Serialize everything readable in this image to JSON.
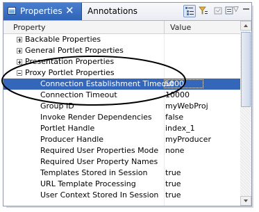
{
  "tabs": {
    "active_label": "Properties",
    "close_glyph": "✕",
    "inactive_label": "Annotations"
  },
  "toolbar": {
    "buttons": [
      "categories-icon",
      "filter-icon",
      "restore-default-icon",
      "advanced-icon"
    ],
    "menu_glyph": "▽"
  },
  "table": {
    "header_property": "Property",
    "header_value": "Value",
    "rows": [
      {
        "name": "Backable Properties",
        "value": "",
        "expander": "plus",
        "indent": 0
      },
      {
        "name": "General Portlet Properties",
        "value": "",
        "expander": "plus",
        "indent": 0
      },
      {
        "name": "Presentation Properties",
        "value": "",
        "expander": "plus",
        "indent": 0
      },
      {
        "name": "Proxy Portlet Properties",
        "value": "",
        "expander": "minus",
        "indent": 0
      },
      {
        "name": "Connection Establishment Timeout",
        "value": "5000",
        "expander": "",
        "indent": 1,
        "selected": true
      },
      {
        "name": "Connection Timeout",
        "value": "10000",
        "expander": "",
        "indent": 1
      },
      {
        "name": "Group ID",
        "value": "myWebProj",
        "expander": "",
        "indent": 1
      },
      {
        "name": "Invoke Render Dependencies",
        "value": "false",
        "expander": "",
        "indent": 1
      },
      {
        "name": "Portlet Handle",
        "value": "index_1",
        "expander": "",
        "indent": 1
      },
      {
        "name": "Producer Handle",
        "value": "myProducer",
        "expander": "",
        "indent": 1
      },
      {
        "name": "Required User Properties Mode",
        "value": "none",
        "expander": "",
        "indent": 1
      },
      {
        "name": "Required User Property Names",
        "value": "",
        "expander": "",
        "indent": 1
      },
      {
        "name": "Templates Stored in Session",
        "value": "true",
        "expander": "",
        "indent": 1
      },
      {
        "name": "URL Template Processing",
        "value": "true",
        "expander": "",
        "indent": 1
      },
      {
        "name": "User Context Stored In Session",
        "value": "true",
        "expander": "",
        "indent": 1
      }
    ]
  },
  "colors": {
    "active_tab": "#3a6fc2",
    "selection": "#3466b9",
    "annotation_ellipse": "#000000"
  }
}
